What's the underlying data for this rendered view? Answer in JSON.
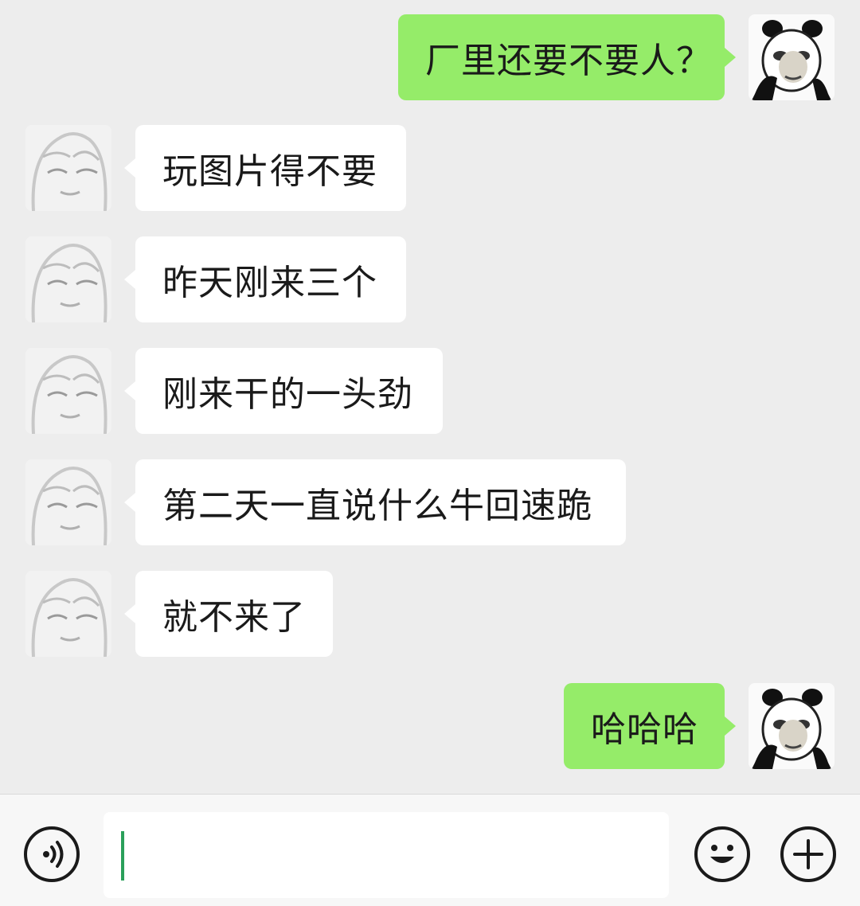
{
  "messages": [
    {
      "from": "me",
      "text": "厂里还要不要人？"
    },
    {
      "from": "other",
      "text": "玩图片得不要"
    },
    {
      "from": "other",
      "text": "昨天刚来三个"
    },
    {
      "from": "other",
      "text": "刚来干的一头劲"
    },
    {
      "from": "other",
      "text": "第二天一直说什么牛回速跪"
    },
    {
      "from": "other",
      "text": "就不来了"
    },
    {
      "from": "me",
      "text": "哈哈哈"
    }
  ],
  "input": {
    "value": "",
    "voice_icon": "voice-icon",
    "emoji_icon": "emoji-icon",
    "plus_icon": "plus-icon"
  },
  "colors": {
    "background": "#ededed",
    "outgoing_bubble": "#95ec69",
    "incoming_bubble": "#ffffff",
    "caret": "#2aa05a"
  }
}
